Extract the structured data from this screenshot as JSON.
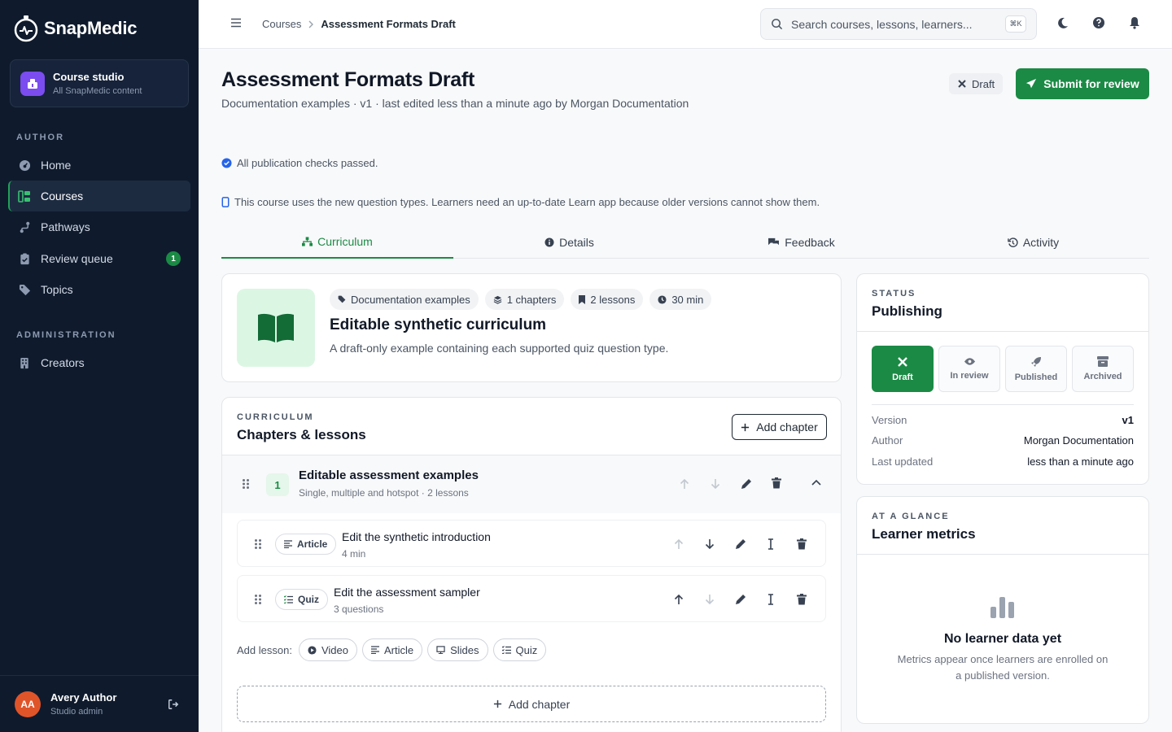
{
  "brand": {
    "name": "SnapMedic"
  },
  "studio": {
    "title": "Course studio",
    "subtitle": "All SnapMedic content"
  },
  "nav": {
    "author_section": "AUTHOR",
    "admin_section": "ADMINISTRATION",
    "items": [
      {
        "label": "Home",
        "icon": "dashboard-icon"
      },
      {
        "label": "Courses",
        "icon": "courses-icon",
        "active": true
      },
      {
        "label": "Pathways",
        "icon": "pathways-icon"
      },
      {
        "label": "Review queue",
        "icon": "review-icon",
        "badge": "1"
      },
      {
        "label": "Topics",
        "icon": "tag-icon"
      },
      {
        "label": "Creators",
        "icon": "building-icon"
      }
    ]
  },
  "user": {
    "initials": "AA",
    "name": "Avery Author",
    "role": "Studio admin"
  },
  "topbar": {
    "breadcrumb": [
      "Courses",
      "Assessment Formats Draft"
    ],
    "search_placeholder": "Search courses, lessons, learners...",
    "search_shortcut": "⌘K"
  },
  "page": {
    "title": "Assessment Formats Draft",
    "subtitle": "Documentation examples · v1 · last edited less than a minute ago by Morgan Documentation",
    "status_pill": "Draft",
    "submit_label": "Submit for review",
    "note_checks": "All publication checks passed.",
    "note_app": "This course uses the new question types. Learners need an up-to-date Learn app because older versions cannot show them."
  },
  "tabs": [
    {
      "label": "Curriculum",
      "active": true
    },
    {
      "label": "Details"
    },
    {
      "label": "Feedback"
    },
    {
      "label": "Activity"
    }
  ],
  "hero": {
    "chips": [
      "Documentation examples",
      "1 chapters",
      "2 lessons",
      "30 min"
    ],
    "title": "Editable synthetic curriculum",
    "description": "A draft-only example containing each supported quiz question type."
  },
  "curriculum": {
    "eyebrow": "CURRICULUM",
    "title": "Chapters & lessons",
    "add_chapter": "Add chapter",
    "chapter": {
      "number": "1",
      "title": "Editable assessment examples",
      "subtitle": "Single, multiple and hotspot · 2 lessons"
    },
    "lessons": [
      {
        "type": "Article",
        "title": "Edit the synthetic introduction",
        "meta": "4 min"
      },
      {
        "type": "Quiz",
        "title": "Edit the assessment sampler",
        "meta": "3 questions"
      }
    ],
    "add_lesson_label": "Add lesson:",
    "add_lesson_types": [
      "Video",
      "Article",
      "Slides",
      "Quiz"
    ],
    "add_chapter_bottom": "Add chapter"
  },
  "status_card": {
    "eyebrow": "STATUS",
    "title": "Publishing",
    "options": [
      "Draft",
      "In review",
      "Published",
      "Archived"
    ],
    "active_option": "Draft",
    "meta": [
      {
        "key": "Version",
        "value": "v1"
      },
      {
        "key": "Author",
        "value": "Morgan Documentation"
      },
      {
        "key": "Last updated",
        "value": "less than a minute ago"
      }
    ]
  },
  "metrics_card": {
    "eyebrow": "AT A GLANCE",
    "title": "Learner metrics",
    "empty_title": "No learner data yet",
    "empty_desc_line1": "Metrics appear once learners are enrolled on",
    "empty_desc_line2": "a published version."
  },
  "colors": {
    "accent": "#1b8a45",
    "sidebar": "#0f1b2d",
    "studio_icon": "#7b4cf0",
    "avatar": "#e0542a"
  }
}
